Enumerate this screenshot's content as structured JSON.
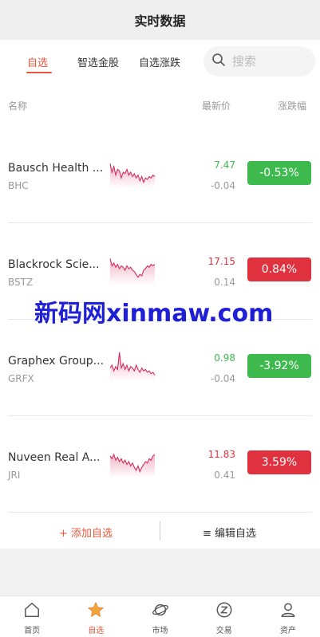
{
  "header": {
    "title": "实时数据"
  },
  "tabs": [
    {
      "label": "自选",
      "active": true
    },
    {
      "label": "智选金股",
      "active": false
    },
    {
      "label": "自选涨跌",
      "active": false
    }
  ],
  "search": {
    "placeholder": "搜索"
  },
  "columns": {
    "name": "名称",
    "price": "最新价",
    "change_pct": "涨跌幅"
  },
  "stocks": [
    {
      "name": "Bausch Health ...",
      "code": "BHC",
      "price": "7.47",
      "change": "-0.04",
      "change_pct": "-0.53%",
      "direction": "down",
      "spark": [
        0.8,
        0.5,
        0.7,
        0.4,
        0.6,
        0.55,
        0.3,
        0.5,
        0.45,
        0.6,
        0.4,
        0.5,
        0.35,
        0.45,
        0.3,
        0.4,
        0.2,
        0.35,
        0.15,
        0.3,
        0.25,
        0.35,
        0.3,
        0.4,
        0.35
      ]
    },
    {
      "name": "Blackrock Scie...",
      "code": "BSTZ",
      "price": "17.15",
      "change": "0.14",
      "change_pct": "0.84%",
      "direction": "up",
      "spark": [
        0.85,
        0.6,
        0.7,
        0.55,
        0.65,
        0.5,
        0.6,
        0.55,
        0.45,
        0.6,
        0.5,
        0.55,
        0.45,
        0.4,
        0.3,
        0.2,
        0.3,
        0.25,
        0.45,
        0.5,
        0.6,
        0.55,
        0.65,
        0.6,
        0.65
      ]
    },
    {
      "name": "Graphex Group...",
      "code": "GRFX",
      "price": "0.98",
      "change": "-0.04",
      "change_pct": "-3.92%",
      "direction": "down",
      "spark": [
        0.4,
        0.5,
        0.3,
        0.45,
        0.35,
        0.95,
        0.4,
        0.55,
        0.35,
        0.5,
        0.3,
        0.45,
        0.4,
        0.3,
        0.5,
        0.35,
        0.25,
        0.4,
        0.3,
        0.35,
        0.25,
        0.3,
        0.2,
        0.25,
        0.15
      ]
    },
    {
      "name": "Nuveen Real A...",
      "code": "JRI",
      "price": "11.83",
      "change": "0.41",
      "change_pct": "3.59%",
      "direction": "up",
      "spark": [
        0.7,
        0.6,
        0.75,
        0.55,
        0.65,
        0.5,
        0.6,
        0.45,
        0.55,
        0.4,
        0.5,
        0.35,
        0.45,
        0.3,
        0.2,
        0.35,
        0.15,
        0.3,
        0.4,
        0.5,
        0.45,
        0.6,
        0.55,
        0.7,
        0.75
      ]
    }
  ],
  "actions": {
    "add": "+ 添加自选",
    "edit": "≡ 编辑自选"
  },
  "watermark": "新码网xinmaw.com",
  "bottom_nav": [
    {
      "label": "首页",
      "icon": "home-icon",
      "active": false
    },
    {
      "label": "自选",
      "icon": "star-icon",
      "active": true
    },
    {
      "label": "市场",
      "icon": "planet-icon",
      "active": false
    },
    {
      "label": "交易",
      "icon": "exchange-icon",
      "active": false
    },
    {
      "label": "资产",
      "icon": "user-icon",
      "active": false
    }
  ],
  "colors": {
    "accent": "#e8573a",
    "up": "#e0313f",
    "down": "#3db94e",
    "spark_line": "#d42a5a"
  }
}
